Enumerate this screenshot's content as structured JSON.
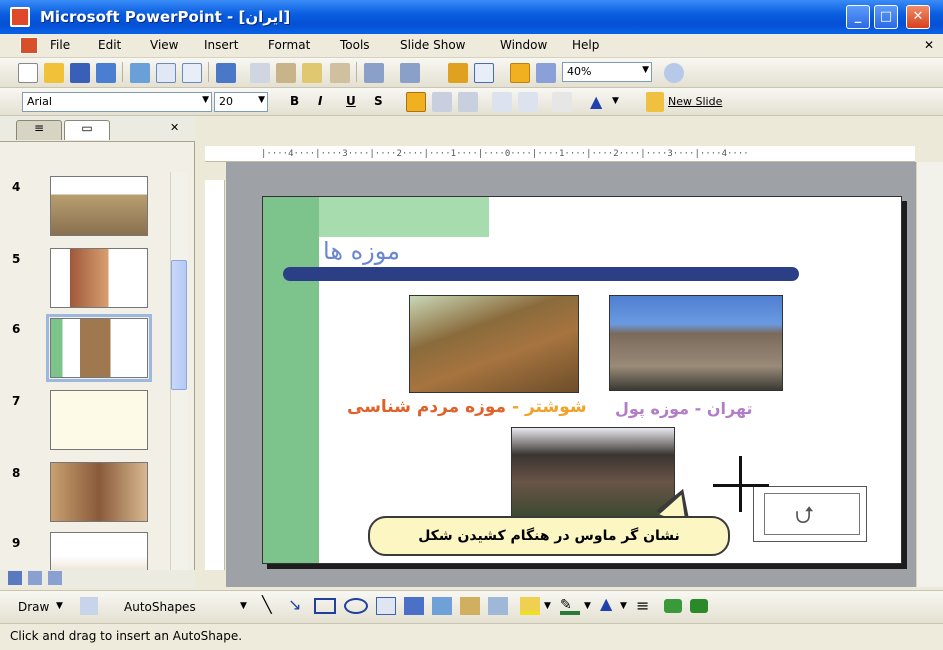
{
  "window": {
    "title": "Microsoft PowerPoint - [ایران]"
  },
  "menu": [
    "File",
    "Edit",
    "View",
    "Insert",
    "Format",
    "Tools",
    "Slide Show",
    "Window",
    "Help"
  ],
  "standard_toolbar": {
    "zoom": "40%"
  },
  "formatting_toolbar": {
    "font": "Arial",
    "size": "20",
    "bold": "B",
    "italic": "I",
    "underline": "U",
    "shadow": "S",
    "new_slide": "New Slide"
  },
  "left_pane": {
    "tabs": [
      "Outline",
      "Slides"
    ],
    "slides": [
      {
        "number": "4"
      },
      {
        "number": "5"
      },
      {
        "number": "6",
        "selected": true
      },
      {
        "number": "7"
      },
      {
        "number": "8"
      },
      {
        "number": "9"
      }
    ]
  },
  "slide": {
    "title": "موزه ها",
    "caption_left_a": "شوشتر - ",
    "caption_left_b": "موزه مردم شناسی",
    "caption_right": "تهران - موزه پول"
  },
  "callout": {
    "text": "نشان گر ماوس در هنگام کشیدن شکل"
  },
  "drawing_toolbar": {
    "draw": "Draw",
    "autoshapes": "AutoShapes"
  },
  "status": {
    "text": "Click and drag to insert an AutoShape."
  },
  "colors": {
    "titlebar": "#0a5fe0",
    "accent_green": "#7cc48b",
    "title_line": "#2b3f86",
    "callout_bg": "#fbf6c2"
  }
}
